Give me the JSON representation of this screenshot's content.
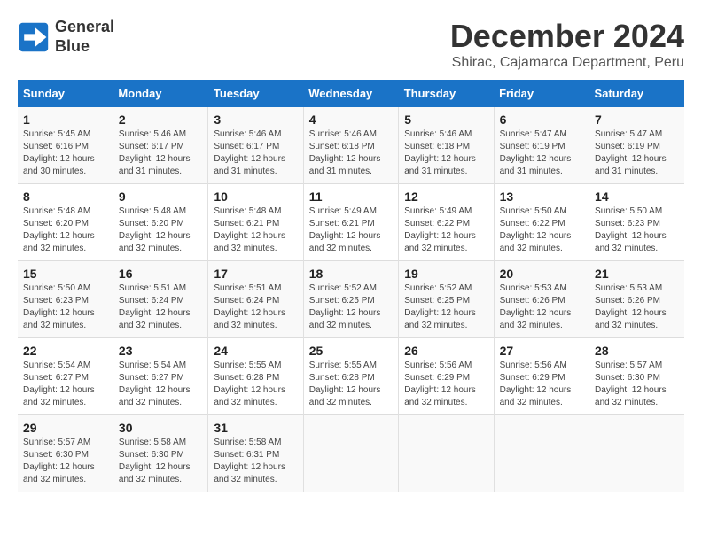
{
  "logo": {
    "line1": "General",
    "line2": "Blue"
  },
  "title": "December 2024",
  "subtitle": "Shirac, Cajamarca Department, Peru",
  "headers": [
    "Sunday",
    "Monday",
    "Tuesday",
    "Wednesday",
    "Thursday",
    "Friday",
    "Saturday"
  ],
  "weeks": [
    [
      {
        "day": "1",
        "sunrise": "5:45 AM",
        "sunset": "6:16 PM",
        "daylight": "12 hours and 30 minutes."
      },
      {
        "day": "2",
        "sunrise": "5:46 AM",
        "sunset": "6:17 PM",
        "daylight": "12 hours and 31 minutes."
      },
      {
        "day": "3",
        "sunrise": "5:46 AM",
        "sunset": "6:17 PM",
        "daylight": "12 hours and 31 minutes."
      },
      {
        "day": "4",
        "sunrise": "5:46 AM",
        "sunset": "6:18 PM",
        "daylight": "12 hours and 31 minutes."
      },
      {
        "day": "5",
        "sunrise": "5:46 AM",
        "sunset": "6:18 PM",
        "daylight": "12 hours and 31 minutes."
      },
      {
        "day": "6",
        "sunrise": "5:47 AM",
        "sunset": "6:19 PM",
        "daylight": "12 hours and 31 minutes."
      },
      {
        "day": "7",
        "sunrise": "5:47 AM",
        "sunset": "6:19 PM",
        "daylight": "12 hours and 31 minutes."
      }
    ],
    [
      {
        "day": "8",
        "sunrise": "5:48 AM",
        "sunset": "6:20 PM",
        "daylight": "12 hours and 32 minutes."
      },
      {
        "day": "9",
        "sunrise": "5:48 AM",
        "sunset": "6:20 PM",
        "daylight": "12 hours and 32 minutes."
      },
      {
        "day": "10",
        "sunrise": "5:48 AM",
        "sunset": "6:21 PM",
        "daylight": "12 hours and 32 minutes."
      },
      {
        "day": "11",
        "sunrise": "5:49 AM",
        "sunset": "6:21 PM",
        "daylight": "12 hours and 32 minutes."
      },
      {
        "day": "12",
        "sunrise": "5:49 AM",
        "sunset": "6:22 PM",
        "daylight": "12 hours and 32 minutes."
      },
      {
        "day": "13",
        "sunrise": "5:50 AM",
        "sunset": "6:22 PM",
        "daylight": "12 hours and 32 minutes."
      },
      {
        "day": "14",
        "sunrise": "5:50 AM",
        "sunset": "6:23 PM",
        "daylight": "12 hours and 32 minutes."
      }
    ],
    [
      {
        "day": "15",
        "sunrise": "5:50 AM",
        "sunset": "6:23 PM",
        "daylight": "12 hours and 32 minutes."
      },
      {
        "day": "16",
        "sunrise": "5:51 AM",
        "sunset": "6:24 PM",
        "daylight": "12 hours and 32 minutes."
      },
      {
        "day": "17",
        "sunrise": "5:51 AM",
        "sunset": "6:24 PM",
        "daylight": "12 hours and 32 minutes."
      },
      {
        "day": "18",
        "sunrise": "5:52 AM",
        "sunset": "6:25 PM",
        "daylight": "12 hours and 32 minutes."
      },
      {
        "day": "19",
        "sunrise": "5:52 AM",
        "sunset": "6:25 PM",
        "daylight": "12 hours and 32 minutes."
      },
      {
        "day": "20",
        "sunrise": "5:53 AM",
        "sunset": "6:26 PM",
        "daylight": "12 hours and 32 minutes."
      },
      {
        "day": "21",
        "sunrise": "5:53 AM",
        "sunset": "6:26 PM",
        "daylight": "12 hours and 32 minutes."
      }
    ],
    [
      {
        "day": "22",
        "sunrise": "5:54 AM",
        "sunset": "6:27 PM",
        "daylight": "12 hours and 32 minutes."
      },
      {
        "day": "23",
        "sunrise": "5:54 AM",
        "sunset": "6:27 PM",
        "daylight": "12 hours and 32 minutes."
      },
      {
        "day": "24",
        "sunrise": "5:55 AM",
        "sunset": "6:28 PM",
        "daylight": "12 hours and 32 minutes."
      },
      {
        "day": "25",
        "sunrise": "5:55 AM",
        "sunset": "6:28 PM",
        "daylight": "12 hours and 32 minutes."
      },
      {
        "day": "26",
        "sunrise": "5:56 AM",
        "sunset": "6:29 PM",
        "daylight": "12 hours and 32 minutes."
      },
      {
        "day": "27",
        "sunrise": "5:56 AM",
        "sunset": "6:29 PM",
        "daylight": "12 hours and 32 minutes."
      },
      {
        "day": "28",
        "sunrise": "5:57 AM",
        "sunset": "6:30 PM",
        "daylight": "12 hours and 32 minutes."
      }
    ],
    [
      {
        "day": "29",
        "sunrise": "5:57 AM",
        "sunset": "6:30 PM",
        "daylight": "12 hours and 32 minutes."
      },
      {
        "day": "30",
        "sunrise": "5:58 AM",
        "sunset": "6:30 PM",
        "daylight": "12 hours and 32 minutes."
      },
      {
        "day": "31",
        "sunrise": "5:58 AM",
        "sunset": "6:31 PM",
        "daylight": "12 hours and 32 minutes."
      },
      null,
      null,
      null,
      null
    ]
  ],
  "labels": {
    "sunrise": "Sunrise: ",
    "sunset": "Sunset: ",
    "daylight": "Daylight: "
  }
}
